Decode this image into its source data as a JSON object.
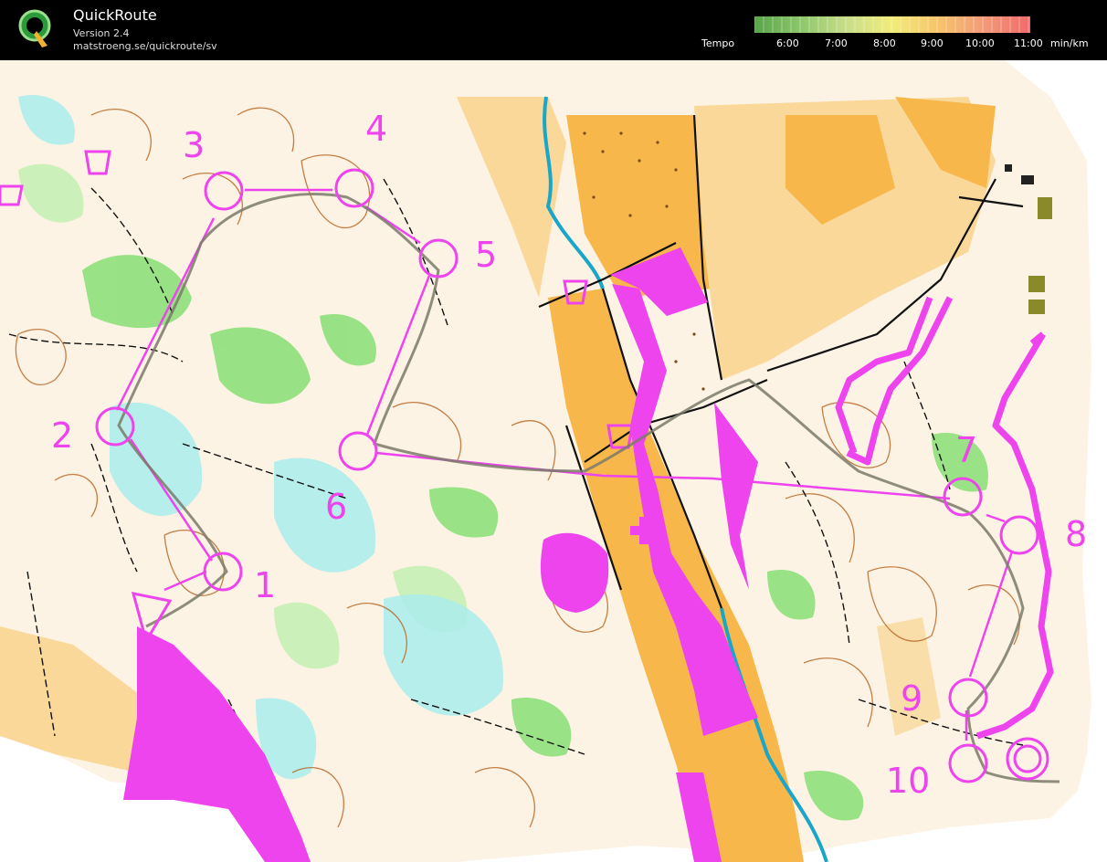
{
  "app": {
    "name": "QuickRoute",
    "version": "Version 2.4",
    "url": "matstroeng.se/quickroute/sv"
  },
  "legend": {
    "label": "Tempo",
    "ticks": [
      "6:00",
      "7:00",
      "8:00",
      "9:00",
      "10:00",
      "11:00"
    ],
    "unit": "min/km",
    "colors": [
      "#5aa34a",
      "#8cc76a",
      "#c8de8a",
      "#f2ec7a",
      "#f7c46a",
      "#f39a7a",
      "#f06a6a"
    ]
  },
  "map": {
    "colors": {
      "open_land": "#f7b74a",
      "rough_open": "#f9d89a",
      "forest_green": "#7fd86a",
      "marsh_blue": "#3fc9c9",
      "course_magenta": "#ee44ee",
      "contour_brown": "#b86a2a"
    },
    "control_labels": [
      "1",
      "2",
      "3",
      "4",
      "5",
      "6",
      "7",
      "8",
      "9",
      "10"
    ]
  }
}
